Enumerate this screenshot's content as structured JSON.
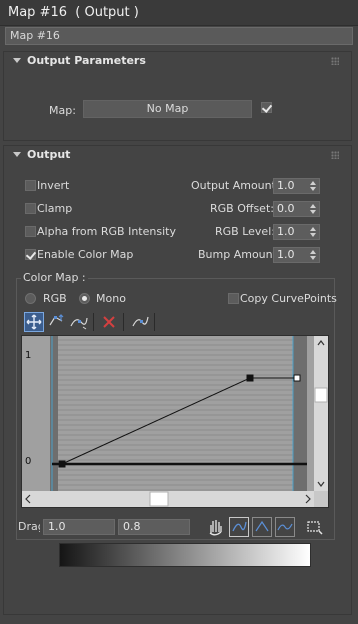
{
  "window": {
    "title": "Map #16  ( Output )"
  },
  "map_name": "Map #16",
  "output_parameters": {
    "header": "Output Parameters",
    "map_label": "Map:",
    "map_button": "No Map",
    "map_enabled": true
  },
  "output": {
    "header": "Output",
    "checkboxes": [
      {
        "label": "Invert",
        "checked": false
      },
      {
        "label": "Clamp",
        "checked": false
      },
      {
        "label": "Alpha from RGB Intensity",
        "checked": false
      },
      {
        "label": "Enable Color Map",
        "checked": true
      }
    ],
    "spinners": [
      {
        "label": "Output Amount:",
        "value": "1.0"
      },
      {
        "label": "RGB Offset:",
        "value": "0.0"
      },
      {
        "label": "RGB Level:",
        "value": "1.0"
      },
      {
        "label": "Bump Amount:",
        "value": "1.0"
      }
    ]
  },
  "color_map": {
    "group_label": "Color Map :",
    "radio_rgb": "RGB",
    "radio_mono": "Mono",
    "mono_selected": true,
    "copy_curve_points": "Copy CurvePoints",
    "copy_curve_points_checked": false,
    "graph": {
      "y_label_top": "1",
      "y_label_bottom": "0",
      "curve_points": [
        {
          "x": 0.0,
          "y": 0.0
        },
        {
          "x": 0.8,
          "y": 1.0
        },
        {
          "x": 1.0,
          "y": 1.0
        }
      ]
    },
    "status_label": "Drag",
    "status_value_1": "1.0",
    "status_value_2": "0.8"
  },
  "icons": {
    "move": "move-icon",
    "scale_point": "scale-point-icon",
    "insert_point": "insert-point-icon",
    "delete_point": "delete-point-icon",
    "reset_curve": "reset-curve-icon",
    "pan": "pan-icon",
    "zoom_extents": "zoom-extents-icon",
    "zoom_horizontal": "zoom-horizontal-icon",
    "zoom_vertical": "zoom-vertical-icon",
    "zoom_region": "zoom-region-icon"
  },
  "colors": {
    "accent": "#5b8fd6",
    "delete": "#d44040",
    "background": "#444444"
  }
}
